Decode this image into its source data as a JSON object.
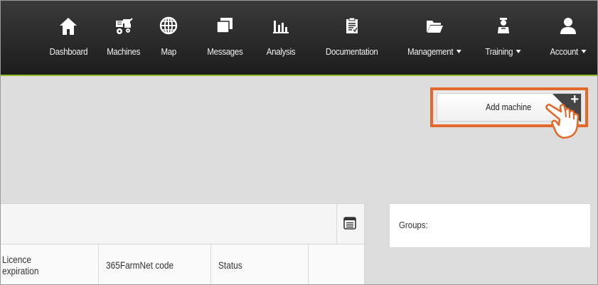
{
  "nav": {
    "items": [
      {
        "label": "Dashboard",
        "icon": "home-icon",
        "dropdown": false
      },
      {
        "label": "Machines",
        "icon": "harvester-icon",
        "dropdown": false
      },
      {
        "label": "Map",
        "icon": "globe-icon",
        "dropdown": false
      },
      {
        "label": "Messages",
        "icon": "messages-icon",
        "dropdown": false
      },
      {
        "label": "Analysis",
        "icon": "bar-chart-icon",
        "dropdown": false
      },
      {
        "label": "Documentation",
        "icon": "clipboard-icon",
        "dropdown": false
      },
      {
        "label": "Management",
        "icon": "folder-icon",
        "dropdown": true
      },
      {
        "label": "Training",
        "icon": "trainer-icon",
        "dropdown": true
      },
      {
        "label": "Account",
        "icon": "user-icon",
        "dropdown": true
      }
    ]
  },
  "add_machine": {
    "label": "Add machine",
    "icon": "plus-icon"
  },
  "table": {
    "columns": [
      "Licence\nexpiration",
      "365FarmNet code",
      "Status",
      ""
    ],
    "toolbar_icon": "list-view-icon"
  },
  "groups": {
    "label": "Groups:"
  },
  "colors": {
    "nav_bg": "#262626",
    "accent_green": "#8fbe2a",
    "highlight_orange": "#e2692a"
  }
}
